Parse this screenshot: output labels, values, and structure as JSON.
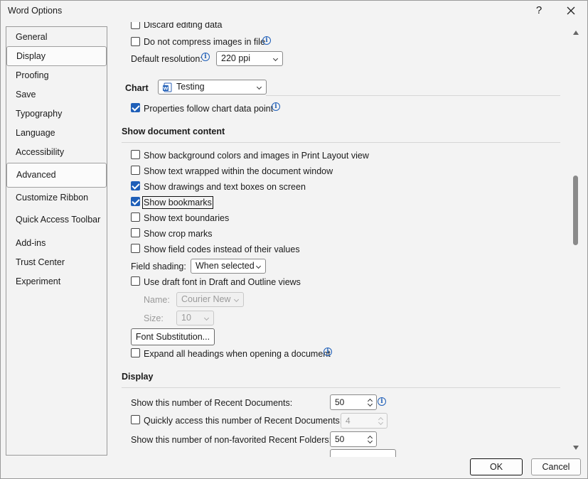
{
  "window": {
    "title": "Word Options",
    "help": "?"
  },
  "nav": {
    "items": [
      {
        "label": "General"
      },
      {
        "label": "Display"
      },
      {
        "label": "Proofing"
      },
      {
        "label": "Save"
      },
      {
        "label": "Typography"
      },
      {
        "label": "Language"
      },
      {
        "label": "Accessibility"
      },
      {
        "label": "Advanced"
      },
      {
        "label": "Customize Ribbon"
      },
      {
        "label": "Quick Access Toolbar"
      },
      {
        "label": "Add-ins"
      },
      {
        "label": "Trust Center"
      },
      {
        "label": "Experiment"
      }
    ]
  },
  "image": {
    "discard_editing": "Discard editing data",
    "no_compress": "Do not compress images in file",
    "default_resolution_label": "Default resolution:",
    "default_resolution_value": "220 ppi"
  },
  "chart": {
    "label": "Chart",
    "selected_doc": "Testing",
    "properties_follow": "Properties follow chart data point"
  },
  "show_content": {
    "heading": "Show document content",
    "options": [
      {
        "label": "Show background colors and images in Print Layout view",
        "checked": false
      },
      {
        "label": "Show text wrapped within the document window",
        "checked": false
      },
      {
        "label": "Show drawings and text boxes on screen",
        "checked": true
      },
      {
        "label": "Show bookmarks",
        "checked": true
      },
      {
        "label": "Show text boundaries",
        "checked": false
      },
      {
        "label": "Show crop marks",
        "checked": false
      },
      {
        "label": "Show field codes instead of their values",
        "checked": false
      }
    ],
    "field_shading_label": "Field shading:",
    "field_shading_value": "When selected",
    "draft_font_label": "Use draft font in Draft and Outline views",
    "name_label": "Name:",
    "name_value": "Courier New",
    "size_label": "Size:",
    "size_value": "10",
    "font_substitution": "Font Substitution...",
    "expand_headings": "Expand all headings when opening a document"
  },
  "display": {
    "heading": "Display",
    "recent_docs_label": "Show this number of Recent Documents:",
    "recent_docs_value": "50",
    "quick_access_label": "Quickly access this number of Recent Documents:",
    "quick_access_value": "4",
    "recent_folders_label": "Show this number of non-favorited Recent Folders:",
    "recent_folders_value": "50"
  },
  "footer": {
    "ok": "OK",
    "cancel": "Cancel"
  }
}
